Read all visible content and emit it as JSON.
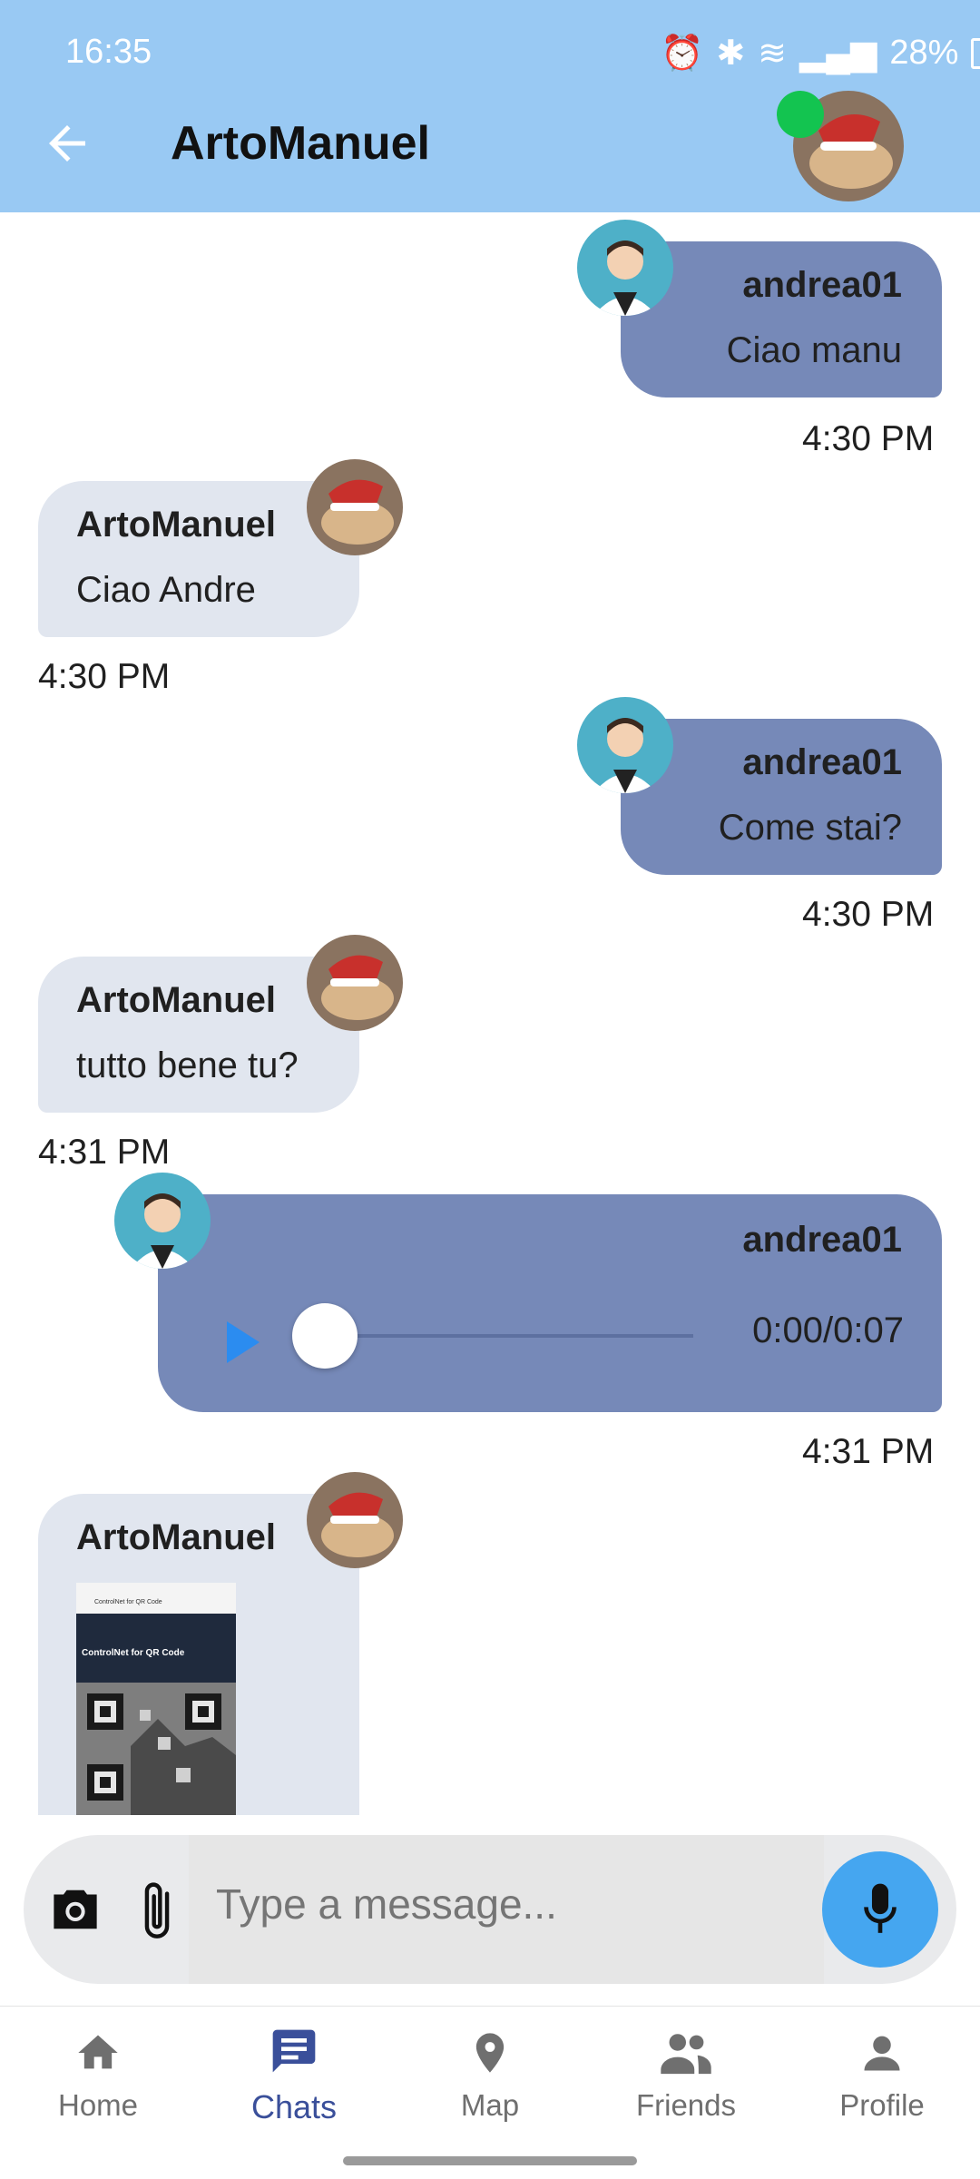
{
  "status_bar": {
    "time": "16:35",
    "battery": "28%"
  },
  "header": {
    "title": "ArtoManuel",
    "online_color": "#13c450"
  },
  "messages": [
    {
      "sender": "andrea01",
      "text": "Ciao manu",
      "time": "4:30 PM",
      "mine": true
    },
    {
      "sender": "ArtoManuel",
      "text": "Ciao Andre",
      "time": "4:30 PM",
      "mine": false
    },
    {
      "sender": "andrea01",
      "text": "Come stai?",
      "time": "4:30 PM",
      "mine": true
    },
    {
      "sender": "ArtoManuel",
      "text": "tutto bene tu?",
      "time": "4:31 PM",
      "mine": false
    },
    {
      "sender": "andrea01",
      "type": "audio",
      "duration": "0:00/0:07",
      "time": "4:31 PM",
      "mine": true
    },
    {
      "sender": "ArtoManuel",
      "type": "image",
      "mine": false,
      "image_text": {
        "browser_title": "ControlNet for QR Code",
        "page_heading": "ControlNet for QR Code"
      }
    }
  ],
  "composer": {
    "placeholder": "Type a message..."
  },
  "nav": {
    "items": [
      {
        "label": "Home",
        "icon": "home-icon"
      },
      {
        "label": "Chats",
        "icon": "chat-icon",
        "active": true
      },
      {
        "label": "Map",
        "icon": "map-pin-icon"
      },
      {
        "label": "Friends",
        "icon": "friends-icon"
      },
      {
        "label": "Profile",
        "icon": "profile-icon"
      }
    ]
  },
  "colors": {
    "header_bg": "#99c9f3",
    "my_bubble": "#7689b8",
    "other_bubble": "#e1e6ef",
    "accent": "#3a4f9a",
    "mic": "#45a6f0"
  }
}
